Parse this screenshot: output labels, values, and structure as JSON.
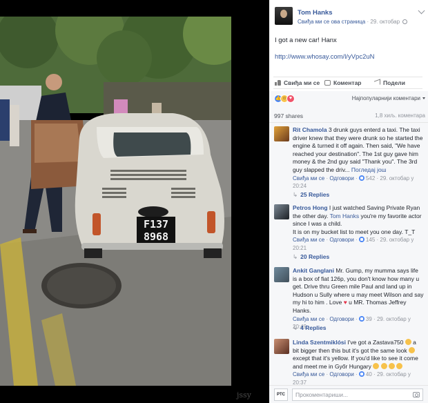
{
  "watermark": "jssy",
  "post": {
    "author": "Tom Hanks",
    "page_like": "Свиђа ми се ова страница",
    "date": "29. октобар",
    "text": "I got a new car! Hanx",
    "link": "http://www.whosay.com/l/yVpc2uN",
    "actions": {
      "like": "Свиђа ми се",
      "comment": "Коментар",
      "share": "Подели"
    },
    "sort": "Најпопуларнији коментари",
    "shares": "997 shares",
    "comments_count": "1,8 хиљ. коментара"
  },
  "comments": [
    {
      "name": "Rit Chamola",
      "text": "3 drunk guys enterd a taxi. The taxi driver knew that they were drunk so he started the engine & turned it off again. Then said, \"We have reached your destination\". The 1st guy gave him money & the 2nd guy said \"Thank you\". The 3rd guy slapped the driv...",
      "more": "Погледај још",
      "like_label": "Свиђа ми се",
      "reply_label": "Одговори",
      "likes": "542",
      "time": "29. октобар у 20:24",
      "replies": "25 Replies"
    },
    {
      "name": "Petros Hong",
      "text_before": "I just watched Saving Private Ryan the other day.",
      "tag": "Tom Hanks",
      "text_after": "you're my favorite actor since I was a child.",
      "text2": "It is on my bucket list to meet you one day. T_T",
      "like_label": "Свиђа ми се",
      "reply_label": "Одговори",
      "likes": "145",
      "time": "29. октобар у 20:21",
      "replies": "20 Replies"
    },
    {
      "name": "Ankit Ganglani",
      "text_before": "Mr. Gump, my mumma says life is a box of fiat 126p, you don't know how many u get. Drive thru Green mile Paul and land up in Hudson u Sully where u may meet Wilson and say my hi to him . Love",
      "heart": "♥",
      "text_after": "u MR. Thomas Jeffrey Hanks.",
      "like_label": "Свиђа ми се",
      "reply_label": "Одговори",
      "likes": "39",
      "time": "29. октобар у 20:49",
      "replies": "4 Replies"
    },
    {
      "name": "Linda Szentmiklósi",
      "text_a": "I've got a Zastava750",
      "text_b": "a bit bigger then this but it's got the same look",
      "text_c": "except that it's yellow. If you'd like to see it come and meet me in Győr Hungary",
      "like_label": "Свиђа ми се",
      "reply_label": "Одговори",
      "likes": "40",
      "time": "29. октобар у 20:37"
    }
  ],
  "composer": {
    "avatar": "PTC",
    "placeholder": "Прокоментариши..."
  },
  "colors": {
    "link": "#365899",
    "panel": "#f6f7f9",
    "meta": "#90949c",
    "like_blue": "#4a86f5"
  }
}
